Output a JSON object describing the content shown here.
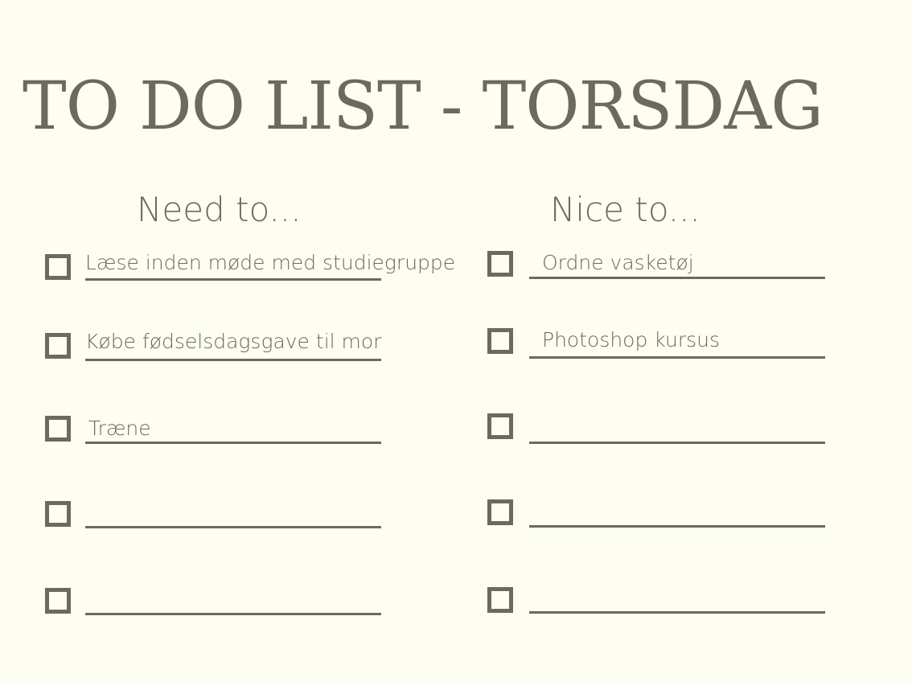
{
  "title": "TO DO LIST - TORSDAG",
  "need": {
    "heading": "Need to...",
    "items": [
      {
        "label": "Læse inden møde med studiegruppe"
      },
      {
        "label": "Købe fødselsdagsgave til mor"
      },
      {
        "label": "Træne"
      },
      {
        "label": ""
      },
      {
        "label": ""
      }
    ]
  },
  "nice": {
    "heading": "Nice to...",
    "items": [
      {
        "label": "Ordne vasketøj"
      },
      {
        "label": "Photoshop kursus"
      },
      {
        "label": ""
      },
      {
        "label": ""
      },
      {
        "label": ""
      }
    ]
  },
  "colors": {
    "background": "#fefdf1",
    "ink": "#6b6a5c"
  }
}
